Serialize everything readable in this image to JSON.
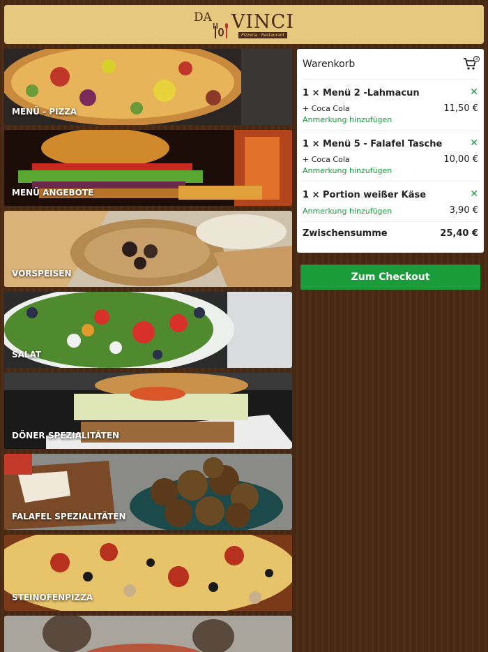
{
  "header": {
    "logo_prefix": "DA",
    "logo_main": "VINCI",
    "logo_sub": "Pizzeria · Restaurant"
  },
  "categories": [
    {
      "label": "MENÜ - PIZZA"
    },
    {
      "label": "MENÜ ANGEBOTE"
    },
    {
      "label": "VORSPEISEN"
    },
    {
      "label": "SALAT"
    },
    {
      "label": "DÖNER SPEZIALITÄTEN"
    },
    {
      "label": "FALAFEL SPEZIALITÄTEN"
    },
    {
      "label": "STEINOFENPIZZA"
    }
  ],
  "cart": {
    "title": "Warenkorb",
    "count": "3",
    "remove_symbol": "✕",
    "items": [
      {
        "name": "1 × Menü 2 -Lahmacun",
        "extra": "+ Coca Cola",
        "price": "11,50 €",
        "note": "Anmerkung hinzufügen"
      },
      {
        "name": "1 × Menü 5 - Falafel Tasche",
        "extra": "+ Coca Cola",
        "price": "10,00 €",
        "note": "Anmerkung hinzufügen"
      },
      {
        "name": "1 × Portion weißer Käse",
        "price": "3,90 €",
        "note": "Anmerkung hinzufügen"
      }
    ],
    "subtotal_label": "Zwischensumme",
    "subtotal_value": "25,40 €"
  },
  "checkout_label": "Zum Checkout",
  "colors": {
    "accent": "#1a9c3a",
    "header_bg": "#e6c97e",
    "page_bg": "#4a2a14"
  }
}
